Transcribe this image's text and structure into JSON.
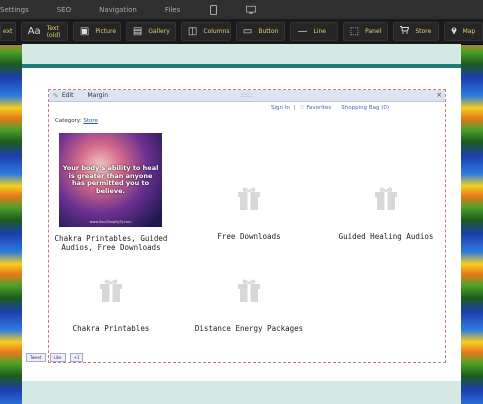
{
  "menubar": {
    "items": [
      "Settings",
      "SEO",
      "Navigation",
      "Files"
    ],
    "devices": [
      "mobile-icon",
      "desktop-icon"
    ]
  },
  "toolbar": {
    "items": [
      {
        "label": "ext",
        "icon": "text-icon"
      },
      {
        "label": "Text (old)",
        "icon": "text-old-icon",
        "glyph": "Aa"
      },
      {
        "label": "Picture",
        "icon": "picture-icon",
        "glyph": "▣"
      },
      {
        "label": "Gallery",
        "icon": "gallery-icon",
        "glyph": "▤"
      },
      {
        "label": "Columns",
        "icon": "columns-icon",
        "glyph": "◫"
      },
      {
        "label": "Button",
        "icon": "button-icon",
        "glyph": "▭"
      },
      {
        "label": "Line",
        "icon": "line-icon",
        "glyph": "—"
      },
      {
        "label": "Panel",
        "icon": "panel-icon",
        "glyph": "⬚"
      },
      {
        "label": "Store",
        "icon": "cart-icon",
        "glyph": "🛒"
      },
      {
        "label": "Map",
        "icon": "map-pin-icon",
        "glyph": "⚲"
      }
    ]
  },
  "widget": {
    "edit_label": "Edit",
    "margin_label": "Margin",
    "grip": "::::",
    "close": "×",
    "links": {
      "sign_in": "Sign In",
      "sep": "|",
      "favorites": "♡ Favorites",
      "bag": "Shopping Bag (0)"
    },
    "category_label": "Category:",
    "category_value": "Store",
    "thumb_caption": "Your body's ability to heal is greater than anyone has permitted you to believe.",
    "thumb_watermark": "www.SoulShopByTy.com",
    "items": [
      {
        "label": "Chakra Printables, Guided Audios, Free Downloads"
      },
      {
        "label": "Free Downloads"
      },
      {
        "label": "Guided Healing Audios"
      },
      {
        "label": "Chakra Printables"
      },
      {
        "label": "Distance Energy Packages"
      }
    ]
  },
  "social": {
    "tweet": "Tweet",
    "like": "Like",
    "plus": "+1"
  },
  "colors": {
    "teal": "#1d7d78",
    "page_bg": "#d4e9e4",
    "toolbar_text": "#e0d070"
  }
}
